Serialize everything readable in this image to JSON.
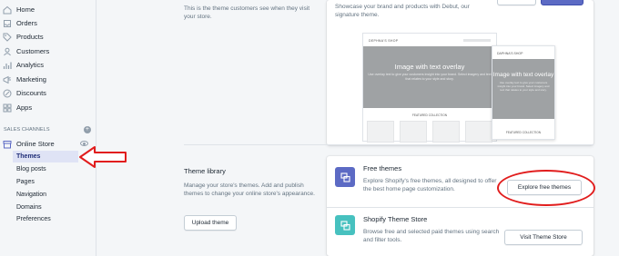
{
  "sidebar": {
    "items": [
      {
        "label": "Home",
        "icon": "home-icon"
      },
      {
        "label": "Orders",
        "icon": "orders-icon"
      },
      {
        "label": "Products",
        "icon": "tag-icon"
      },
      {
        "label": "Customers",
        "icon": "customers-icon"
      },
      {
        "label": "Analytics",
        "icon": "analytics-icon"
      },
      {
        "label": "Marketing",
        "icon": "marketing-icon"
      },
      {
        "label": "Discounts",
        "icon": "discounts-icon"
      },
      {
        "label": "Apps",
        "icon": "apps-icon"
      }
    ],
    "sales_channels_label": "SALES CHANNELS",
    "online_store_label": "Online Store",
    "sub_items": [
      "Themes",
      "Blog posts",
      "Pages",
      "Navigation",
      "Domains",
      "Preferences"
    ]
  },
  "current_theme": {
    "left_desc": "This is the theme customers see when they visit your store.",
    "card_desc": "Showcase your brand and products with Debut, our signature theme.",
    "preview": {
      "desktop_brand": "DEPHNA'S SHOP",
      "mobile_brand": "DAPHNA'S SHOP",
      "hero_title": "Image with text overlay",
      "hero_sub": "Use overlay text to give your customers insight into your brand. Select imagery and text that relates to your style and story.",
      "featured": "FEATURED COLLECTION",
      "mobile_featured": "FEATURED COLLECTION"
    }
  },
  "theme_library": {
    "title": "Theme library",
    "desc": "Manage your store's themes. Add and publish themes to change your online store's appearance.",
    "upload_button": "Upload theme",
    "free_themes": {
      "title": "Free themes",
      "desc": "Explore Shopify's free themes, all designed to offer the best home page customization.",
      "button": "Explore free themes",
      "icon_color": "#5c6ac4"
    },
    "theme_store": {
      "title": "Shopify Theme Store",
      "desc": "Browse free and selected paid themes using search and filter tools.",
      "button": "Visit Theme Store",
      "icon_color": "#47c1bf"
    }
  },
  "colors": {
    "annotation": "#e11d1d",
    "accent": "#5c6ac4"
  }
}
